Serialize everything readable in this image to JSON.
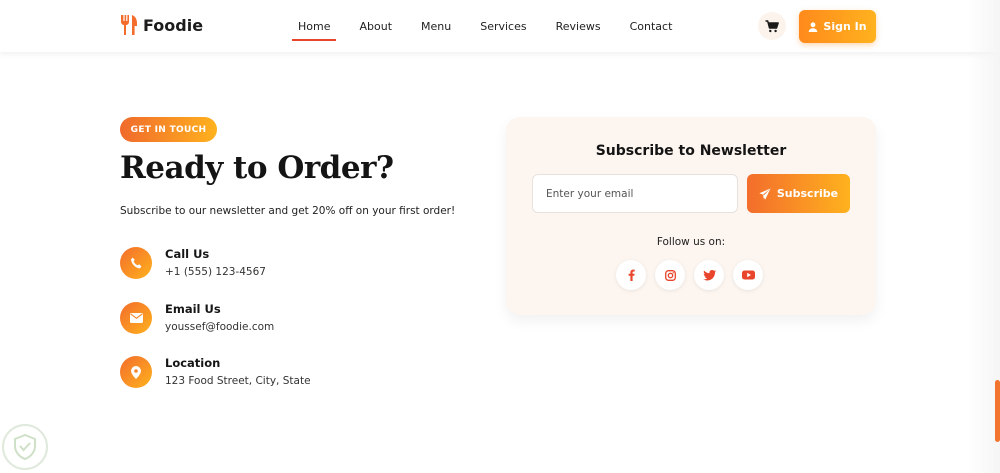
{
  "brand": {
    "name": "Foodie",
    "icon": "utensils-icon",
    "accent": "#f36d2c"
  },
  "nav": {
    "links": [
      "Home",
      "About",
      "Menu",
      "Services",
      "Reviews",
      "Contact"
    ],
    "active": "Home",
    "cart_icon": "cart-icon",
    "signin_label": "Sign In",
    "signin_icon": "user-icon"
  },
  "contact_section": {
    "badge": "GET IN TOUCH",
    "title": "Ready to Order?",
    "subtitle": "Subscribe to our newsletter and get 20% off on your first order!",
    "items": [
      {
        "icon": "phone-icon",
        "title": "Call Us",
        "value": "+1 (555) 123-4567"
      },
      {
        "icon": "envelope-icon",
        "title": "Email Us",
        "value": "youssef@foodie.com"
      },
      {
        "icon": "map-pin-icon",
        "title": "Location",
        "value": "123 Food Street, City, State"
      }
    ]
  },
  "newsletter": {
    "title": "Subscribe to Newsletter",
    "input_placeholder": "Enter your email",
    "button_label": "Subscribe",
    "button_icon": "paper-plane-icon",
    "follow_label": "Follow us on:",
    "socials": [
      "facebook-icon",
      "instagram-icon",
      "twitter-icon",
      "youtube-icon"
    ]
  },
  "colors": {
    "gradient_start": "#f36d2c",
    "gradient_end": "#ffb21e",
    "card_bg": "#fdf5ef"
  }
}
